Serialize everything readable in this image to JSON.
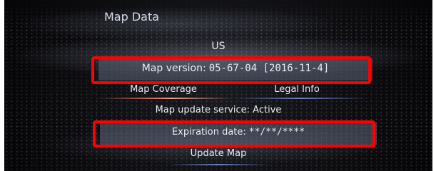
{
  "screen": {
    "title": "Map Data"
  },
  "region": "US",
  "map_version": {
    "label": "Map version:",
    "value": "05-67-04  [2016-11-4]"
  },
  "tabs": [
    {
      "label": "Map Coverage",
      "selected": true
    },
    {
      "label": "Legal Info",
      "selected": false
    }
  ],
  "service": {
    "text": "Map update service: Active"
  },
  "expiration": {
    "label": "Expiration date:",
    "value": "**/**/****"
  },
  "update_button": {
    "label": "Update Map"
  },
  "colors": {
    "highlight_box": "#ff0000",
    "selected_tab_accent": "#e2735d",
    "tab_accent": "#6e7fc5",
    "background": "#0b0b0e"
  }
}
